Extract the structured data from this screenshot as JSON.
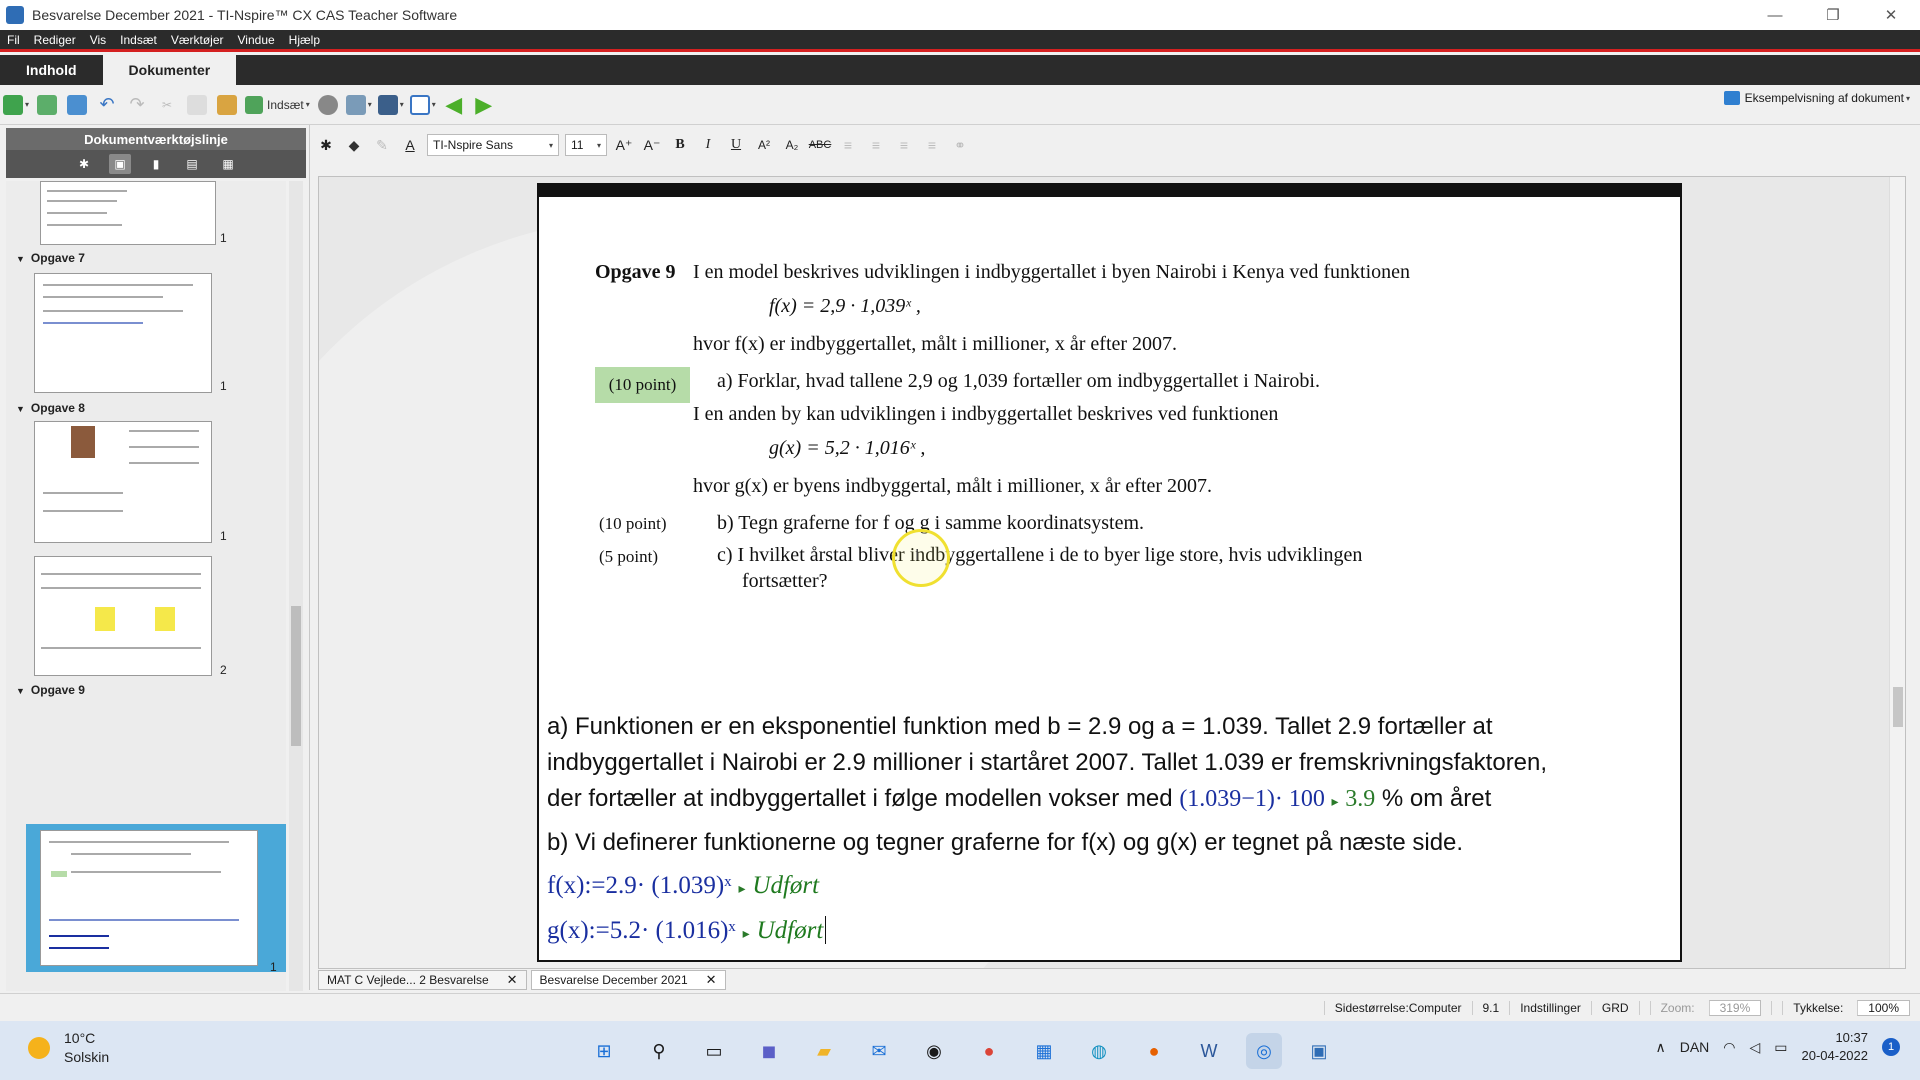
{
  "window": {
    "title": "Besvarelse December 2021 - TI-Nspire™ CX CAS Teacher Software",
    "minimize": "—",
    "maximize": "❐",
    "close": "✕"
  },
  "menu": [
    "Fil",
    "Rediger",
    "Vis",
    "Indsæt",
    "Værktøjer",
    "Vindue",
    "Hjælp"
  ],
  "tabs": {
    "content": "Indhold",
    "documents": "Dokumenter"
  },
  "toolbar": {
    "insert_label": "Indsæt",
    "preview_label": "Eksempelvisning af dokument"
  },
  "sidebar": {
    "header": "Dokumentværktøjslinje",
    "problems": [
      {
        "label": "Opgave 7",
        "page": "1"
      },
      {
        "label": "Opgave 8",
        "page": "1"
      },
      {
        "label": "Opgave 9",
        "page": "1"
      }
    ],
    "top_page": "1",
    "second_page_of_8": "2"
  },
  "format": {
    "font": "TI-Nspire Sans",
    "size": "11",
    "bold": "B",
    "italic": "I",
    "underline": "U",
    "sup": "A²",
    "sub": "A₂",
    "abc": "ABC"
  },
  "scan": {
    "heading": "Opgave 9",
    "intro": "I en model beskrives udviklingen i indbyggertallet i byen Nairobi i Kenya ved funktionen",
    "f_formula": "f(x) = 2,9 · 1,039ˣ ,",
    "f_desc": "hvor f(x) er indbyggertallet, målt i millioner, x år efter 2007.",
    "points_a": "(10 point)",
    "q_a": "a)  Forklar, hvad tallene 2,9 og 1,039 fortæller om indbyggertallet i Nairobi.",
    "intro2": "I en anden by kan udviklingen i indbyggertallet beskrives ved funktionen",
    "g_formula": "g(x) = 5,2 · 1,016ˣ ,",
    "g_desc": "hvor g(x) er byens indbyggertal, målt i millioner, x år efter 2007.",
    "points_b": "(10 point)",
    "q_b": "b)  Tegn graferne for f og g i samme koordinatsystem.",
    "points_c": "(5 point)",
    "q_c1": "c)  I hvilket årstal bliver indbyggertallene i de to byer lige store, hvis udviklingen",
    "q_c2": "fortsætter?"
  },
  "answers": {
    "a_line1": "a) Funktionen er en eksponentiel funktion med b = 2.9 og a = 1.039. Tallet 2.9 fortæller at",
    "a_line2": "indbyggertallet i Nairobi er 2.9 millioner i startåret 2007. Tallet 1.039 er fremskrivningsfaktoren,",
    "a_line3_pre": "der fortæller at indbyggertallet i følge modellen vokser med",
    "a_calc": "(1.039−1)· 100",
    "a_arrow": "▸",
    "a_result": "3.9",
    "a_line3_post": "% om året",
    "b_line": "b) Vi definerer funktionerne og tegner graferne for f(x) og g(x) er tegnet på næste side.",
    "f_def": "f(x):=2.9· (1.039)ˣ",
    "g_def": "g(x):=5.2· (1.016)ˣ",
    "done": "Udført"
  },
  "doctabs": {
    "tab1": "MAT C Vejlede... 2  Besvarelse",
    "tab2": "Besvarelse December 2021",
    "close": "✕"
  },
  "status": {
    "page_size": "Sidestørrelse:Computer",
    "page": "9.1",
    "settings": "Indstillinger",
    "grd": "GRD",
    "zoom_label": "Zoom:",
    "zoom": "319%",
    "thickness_label": "Tykkelse:",
    "thickness": "100%"
  },
  "taskbar": {
    "temp": "10°C",
    "weather": "Solskin",
    "lang": "DAN",
    "time": "10:37",
    "date": "20-04-2022",
    "notifications": "1"
  },
  "colors": {
    "accent_red": "#d42020",
    "math_blue": "#1a2fa0",
    "math_green": "#2a7a2a",
    "points_green": "#b6dca8",
    "selection_blue": "#4aa8d8"
  }
}
